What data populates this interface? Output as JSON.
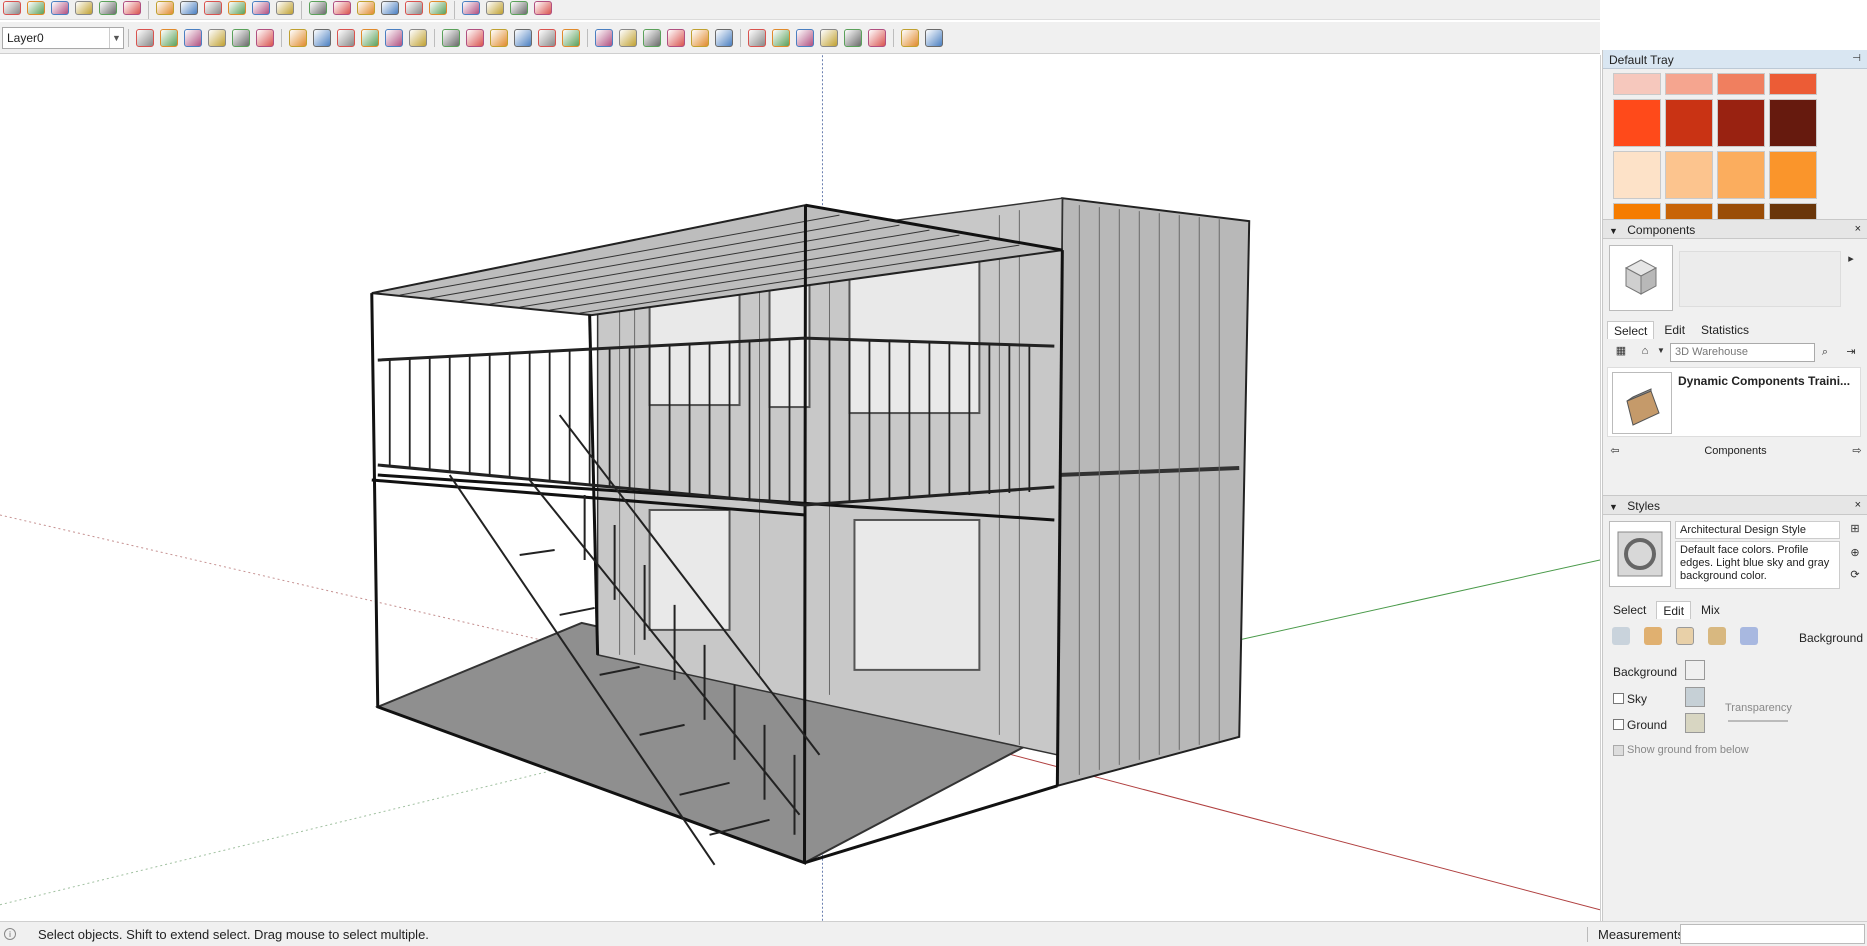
{
  "toolbar": {
    "layer_selector": "Layer0",
    "row1_icons": [
      "eraser",
      "pencil",
      "paint-bucket",
      "move",
      "rotate",
      "scale",
      "tape-measure",
      "text",
      "orbit",
      "pan",
      "zoom",
      "zoom-extents",
      "component",
      "sandbox",
      "user",
      "warehouse",
      "home",
      "house",
      "extension-warehouse",
      "camera",
      "section",
      "styles"
    ],
    "row2_icons": [
      "solid-tools",
      "union",
      "subtract",
      "trim",
      "split",
      "outer-shell",
      "undo",
      "redo",
      "shadows",
      "shape",
      "arc",
      "rectangle",
      "circle",
      "polygon",
      "follow-me",
      "offset",
      "push-pull",
      "intersect",
      "extrude",
      "sweep",
      "loft",
      "twist",
      "taper",
      "bend",
      "skew",
      "array",
      "mirror",
      "flatten",
      "curve",
      "spline",
      "helix",
      "surface"
    ]
  },
  "status": {
    "hint": "Select objects. Shift to extend select. Drag mouse to select multiple.",
    "measurements_label": "Measurements",
    "measurements_value": ""
  },
  "tray": {
    "title": "Default Tray",
    "materials_colors": [
      "#f6c8bd",
      "#f5a58f",
      "#f07f5f",
      "#ec5c36",
      "#ff4a1a",
      "#c93314",
      "#992211",
      "#661a0e",
      "#fde2c8",
      "#fcc48e",
      "#fbad5e",
      "#fa952b",
      "#f57c00",
      "#c86408",
      "#9a4d08",
      "#6a360a"
    ],
    "components": {
      "header": "Components",
      "tabs": [
        "Select",
        "Edit",
        "Statistics"
      ],
      "search_placeholder": "3D Warehouse",
      "result_title": "Dynamic Components Traini...",
      "footer": "Components"
    },
    "styles": {
      "header": "Styles",
      "style_name": "Architectural Design Style",
      "style_description": "Default face colors. Profile edges. Light blue sky and gray background color.",
      "tabs": [
        "Select",
        "Edit",
        "Mix"
      ],
      "edit_section": "Background",
      "background_label": "Background",
      "sky_label": "Sky",
      "ground_label": "Ground",
      "transparency_label": "Transparency",
      "show_ground_label": "Show ground from below",
      "background_color": "#ffffff",
      "sky_color": "#c6d0d6",
      "ground_color": "#d8d6c2"
    }
  }
}
